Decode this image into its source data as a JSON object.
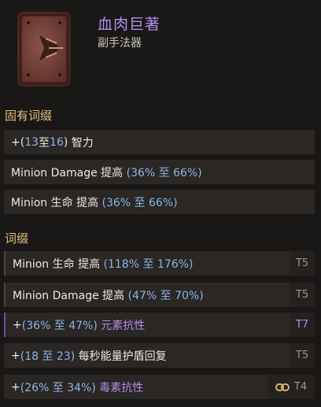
{
  "item": {
    "name": "血肉巨著",
    "type": "副手法器",
    "icon": "flesh-tome-icon"
  },
  "implicit": {
    "title": "固有词缀",
    "rows": [
      {
        "prefix": "+(",
        "range_lo": "13",
        "sep": " 至 ",
        "range_hi": "16",
        "suffix": ") ",
        "stat": "智力"
      },
      {
        "text_a": "Minion Damage 提高 ",
        "range": "(36% 至 66%)"
      },
      {
        "text_a": "Minion 生命 提高 ",
        "range": "(36% 至 66%)"
      }
    ]
  },
  "affixes": {
    "title": "词缀",
    "rows": [
      {
        "text_a": "Minion 生命 提高 ",
        "range": "(118% 至 176%)",
        "tier": "T5"
      },
      {
        "text_a": "Minion Damage 提高 ",
        "range": "(47% 至 70%)",
        "tier": "T5"
      },
      {
        "prefix": "+",
        "range": "(36% 至 47%)",
        "stat": " 元素抗性",
        "tier": "T7"
      },
      {
        "prefix": "+",
        "range": "(18 至 23)",
        "stat": " 每秒能量护盾回复",
        "tier": "T5"
      },
      {
        "prefix": "+",
        "range": "(26% 至 34%)",
        "stat": " 毒素抗性",
        "tier": "T4",
        "tier_icon": "link-icon"
      }
    ]
  },
  "colors": {
    "item_name": "#b48ee8",
    "section_title": "#e3c07a",
    "range_blue": "#8fb2e8",
    "row_bg": "#2a2725"
  }
}
